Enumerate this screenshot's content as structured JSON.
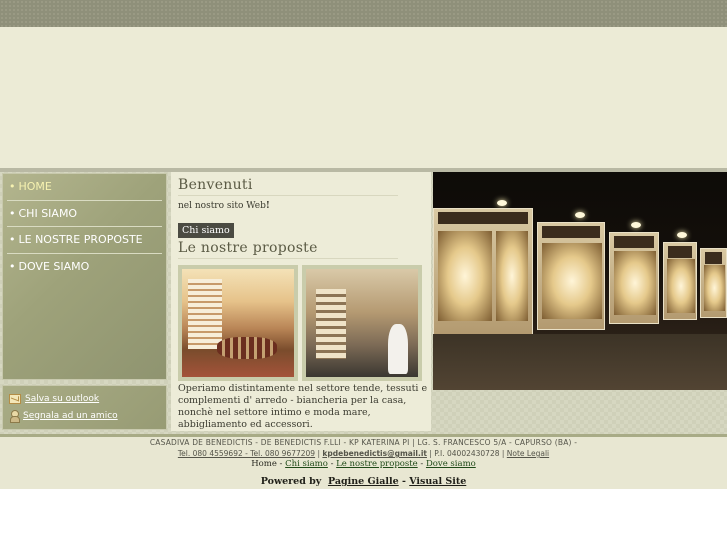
{
  "nav": {
    "items": [
      {
        "label": "HOME"
      },
      {
        "label": "CHI SIAMO"
      },
      {
        "label": "LE NOSTRE PROPOSTE"
      },
      {
        "label": "DOVE SIAMO"
      }
    ],
    "bullet": "•"
  },
  "side_links": {
    "save": "Salva su outlook",
    "share": "Segnala ad un amico"
  },
  "content": {
    "welcome_title": "Benvenuti",
    "intro_text": "nel nostro sito Web",
    "intro_bang": "!",
    "chi_siamo_button": "Chi siamo",
    "proposte_title": "Le nostre proposte",
    "body_text": "Operiamo distintamente nel settore tende, tessuti e complementi d' arredo - biancheria per la casa, nonchè nel settore intimo e moda mare, abbigliamento ed accessori."
  },
  "footer": {
    "company_line": "CASADIVA DE BENEDICTIS - DE BENEDICTIS F.LLI - KP KATERINA PI | LG. S. FRANCESCO 5/A - CAPURSO (BA) -",
    "phones": "Tel. 080 4559692 - Tel. 080 9677209",
    "email": "kpdebenedictis@gmail.it",
    "piva": " | P.I. 04002430728 | ",
    "legal": "Note Legali",
    "links": [
      "Home",
      "Chi siamo",
      "Le nostre proposte",
      "Dove siamo"
    ],
    "separator": " - ",
    "powered_by": "Powered by",
    "pagine_gialle": "Pagine Gialle",
    "dash": " - ",
    "visual_site": "Visual Site"
  },
  "colors": {
    "topbar": "#8f907a",
    "header": "#ecebd6",
    "sidebar": "#9ea27a",
    "content_bg": "#edecd8",
    "chi_siamo_button": "#4b4b42"
  }
}
